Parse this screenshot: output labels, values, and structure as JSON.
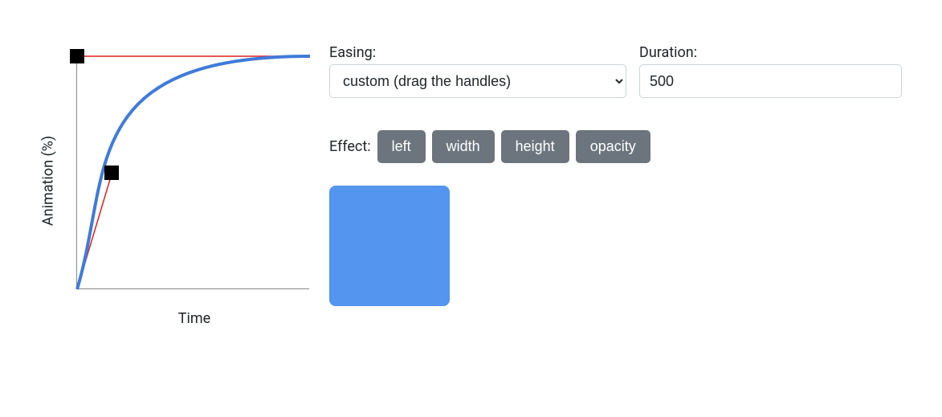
{
  "labels": {
    "easing": "Easing:",
    "duration": "Duration:",
    "effect": "Effect:"
  },
  "easing": {
    "selected": "custom (drag the handles)"
  },
  "duration": {
    "value": "500"
  },
  "effect": {
    "buttons": [
      {
        "id": "left",
        "label": "left"
      },
      {
        "id": "width",
        "label": "width"
      },
      {
        "id": "height",
        "label": "height"
      },
      {
        "id": "opacity",
        "label": "opacity"
      }
    ]
  },
  "chart_data": {
    "type": "line",
    "title": "",
    "xlabel": "Time",
    "ylabel": "Animation (%)",
    "xlim": [
      0,
      1
    ],
    "ylim": [
      0,
      100
    ],
    "series": [
      {
        "name": "easing-curve",
        "color": "#3f7bd9",
        "type": "cubic-bezier",
        "bezier": [
          0.15,
          0.5,
          0,
          1.0
        ]
      },
      {
        "name": "handle-line-1",
        "color": "#e02020",
        "x": [
          0,
          0.15
        ],
        "values": [
          0,
          50
        ]
      },
      {
        "name": "handle-line-2",
        "color": "#e02020",
        "x": [
          0,
          1
        ],
        "values": [
          100,
          100
        ]
      }
    ],
    "handles": [
      {
        "x": 0.15,
        "y": 50
      },
      {
        "x": 0.0,
        "y": 100
      }
    ]
  },
  "preview": {
    "color": "#5395ef"
  }
}
